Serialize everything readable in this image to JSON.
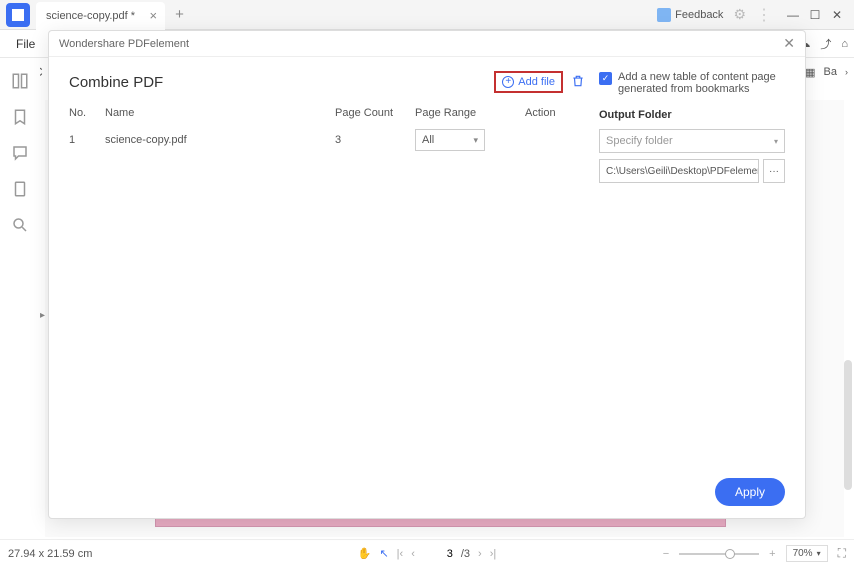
{
  "tabs": {
    "file_tab": "science-copy.pdf *"
  },
  "feedback_label": "Feedback",
  "menubar": {
    "file": "File"
  },
  "toolrow_right_badge": "Ba",
  "statusbar": {
    "dimensions": "27.94 x 21.59 cm",
    "current_page": "3",
    "total_pages": "/3",
    "zoom": "70%"
  },
  "modal": {
    "title": "Wondershare PDFelement",
    "heading": "Combine PDF",
    "add_file_label": "Add file",
    "columns": {
      "no": "No.",
      "name": "Name",
      "page_count": "Page Count",
      "page_range": "Page Range",
      "action": "Action"
    },
    "rows": [
      {
        "no": "1",
        "name": "science-copy.pdf",
        "page_count": "3",
        "page_range": "All"
      }
    ],
    "toc_checkbox_label": "Add a new table of content page generated from bookmarks",
    "output_folder_label": "Output Folder",
    "specify_folder_placeholder": "Specify folder",
    "output_path": "C:\\Users\\Geili\\Desktop\\PDFelement\\Co",
    "apply_label": "Apply"
  }
}
